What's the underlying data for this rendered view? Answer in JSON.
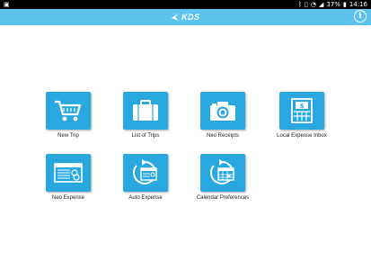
{
  "status_bar": {
    "battery": "37%",
    "time": "14:16"
  },
  "header": {
    "logo_text": "KDS",
    "info_icon": "info-icon",
    "info_glyph": "i",
    "color": "#5bc3ec"
  },
  "tiles": [
    {
      "label": "New Trip",
      "icon": "shopping-cart-icon"
    },
    {
      "label": "List of Trips",
      "icon": "suitcase-icon"
    },
    {
      "label": "Neo Receipts",
      "icon": "camera-icon"
    },
    {
      "label": "Local Expense Inbox",
      "icon": "expense-inbox-icon"
    },
    {
      "label": "Neo Expense",
      "icon": "expense-report-icon"
    },
    {
      "label": "Auto Expense",
      "icon": "auto-expense-icon"
    },
    {
      "label": "Calendar Preferences",
      "icon": "calendar-refresh-icon"
    }
  ],
  "tile_color": "#29a8e0"
}
